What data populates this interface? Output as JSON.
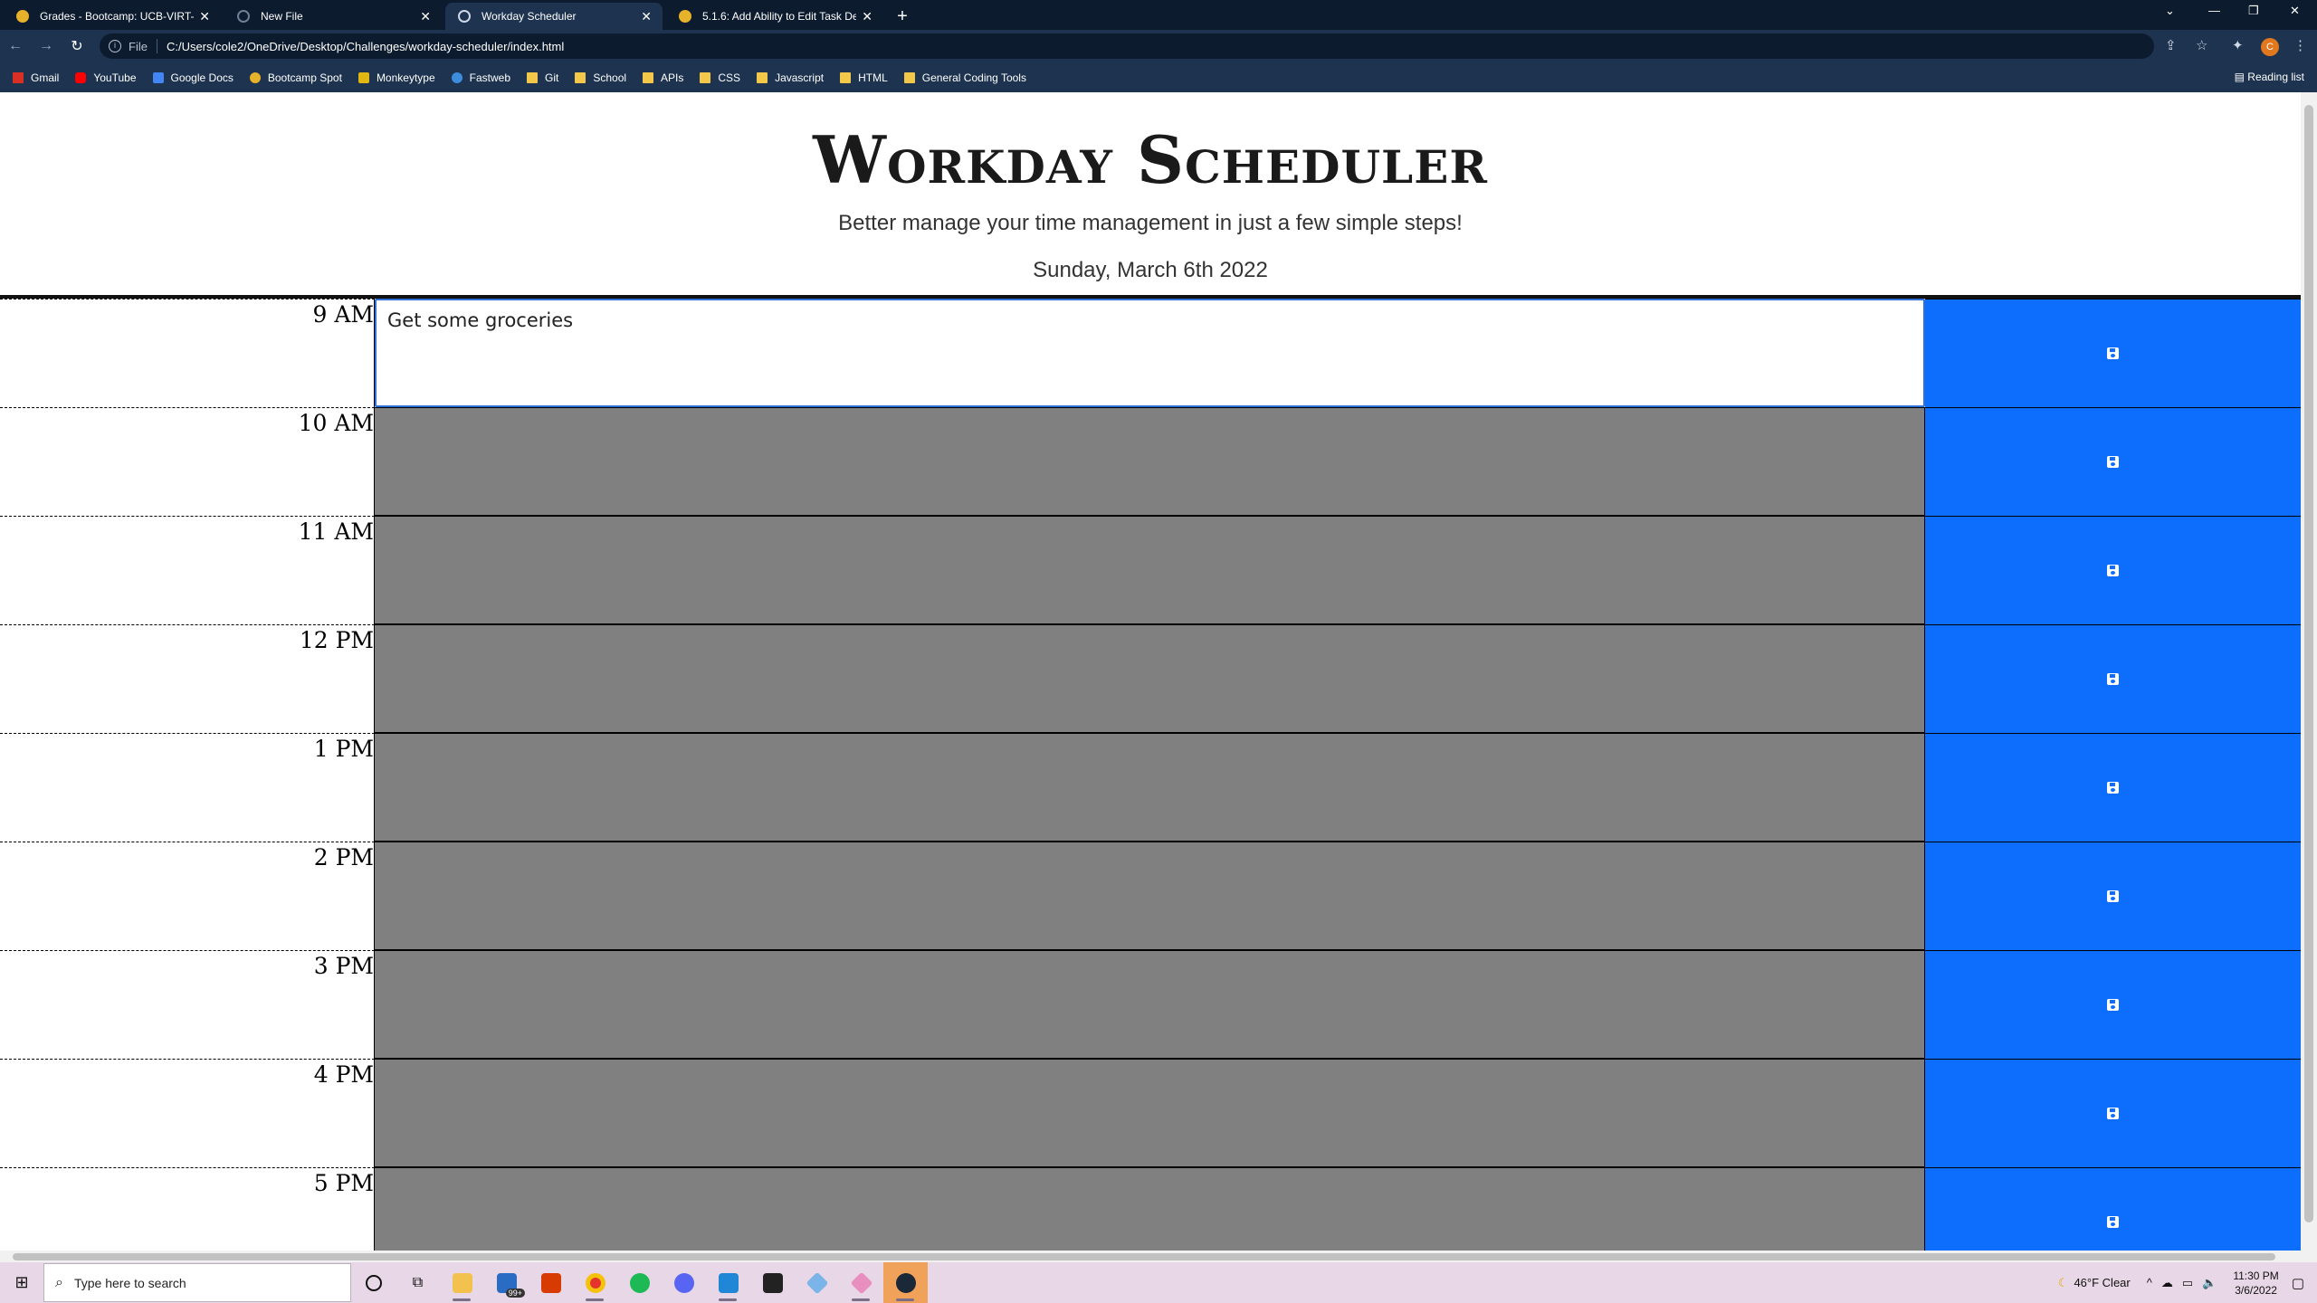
{
  "browser": {
    "tabs": [
      {
        "title": "Grades - Bootcamp: UCB-VIRT-B",
        "active": false,
        "favicon": "bootcamp-spot-icon"
      },
      {
        "title": "New File",
        "active": false,
        "favicon": "loading-icon"
      },
      {
        "title": "Workday Scheduler",
        "active": true,
        "favicon": "globe-icon"
      },
      {
        "title": "5.1.6: Add Ability to Edit Task De",
        "active": false,
        "favicon": "bootcamp-spot-icon"
      }
    ],
    "address": {
      "scheme_label": "File",
      "url": "C:/Users/cole2/OneDrive/Desktop/Challenges/workday-scheduler/index.html"
    },
    "profile_initial": "C",
    "bookmarks": [
      {
        "label": "Gmail",
        "icon": "gmail-icon"
      },
      {
        "label": "YouTube",
        "icon": "youtube-icon"
      },
      {
        "label": "Google Docs",
        "icon": "google-docs-icon"
      },
      {
        "label": "Bootcamp Spot",
        "icon": "bootcamp-spot-icon"
      },
      {
        "label": "Monkeytype",
        "icon": "monkeytype-icon"
      },
      {
        "label": "Fastweb",
        "icon": "fastweb-icon"
      },
      {
        "label": "Git",
        "icon": "folder-icon"
      },
      {
        "label": "School",
        "icon": "folder-icon"
      },
      {
        "label": "APIs",
        "icon": "folder-icon"
      },
      {
        "label": "CSS",
        "icon": "folder-icon"
      },
      {
        "label": "Javascript",
        "icon": "folder-icon"
      },
      {
        "label": "HTML",
        "icon": "folder-icon"
      },
      {
        "label": "General Coding Tools",
        "icon": "folder-icon"
      }
    ],
    "reading_list": "Reading list"
  },
  "page": {
    "title": "Workday Scheduler",
    "lead": "Better manage your time management in just a few simple steps!",
    "current_day": "Sunday, March 6th 2022",
    "time_blocks": [
      {
        "hour": "9 AM",
        "task": "Get some groceries",
        "state": "present"
      },
      {
        "hour": "10 AM",
        "task": "",
        "state": "future"
      },
      {
        "hour": "11 AM",
        "task": "",
        "state": "future"
      },
      {
        "hour": "12 PM",
        "task": "",
        "state": "future"
      },
      {
        "hour": "1 PM",
        "task": "",
        "state": "future"
      },
      {
        "hour": "2 PM",
        "task": "",
        "state": "future"
      },
      {
        "hour": "3 PM",
        "task": "",
        "state": "future"
      },
      {
        "hour": "4 PM",
        "task": "",
        "state": "future"
      },
      {
        "hour": "5 PM",
        "task": "",
        "state": "future"
      }
    ],
    "colors": {
      "save": "#0d6efd",
      "future": "#808080",
      "present": "#ffffff"
    }
  },
  "taskbar": {
    "search_placeholder": "Type here to search",
    "weather": "46°F  Clear",
    "time": "11:30 PM",
    "date": "3/6/2022",
    "mail_badge": "99+"
  }
}
